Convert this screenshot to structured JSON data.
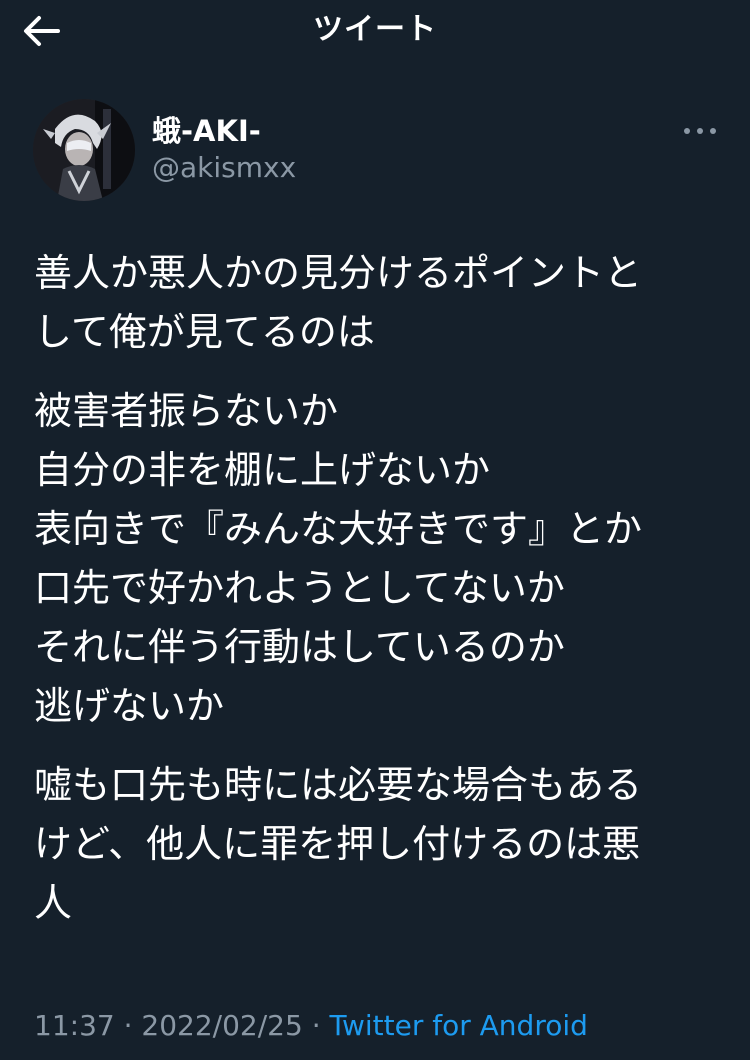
{
  "header": {
    "title": "ツイート"
  },
  "tweet": {
    "author": {
      "display_name": "蛾-AKI-",
      "handle": "@akismxx"
    },
    "paragraphs": [
      [
        "善人か悪人かの見分けるポイントと",
        "して俺が見てるのは"
      ],
      [
        "被害者振らないか",
        "自分の非を棚に上げないか",
        "表向きで『みんな大好きです』とか",
        "口先で好かれようとしてないか",
        "それに伴う行動はしているのか",
        "逃げないか"
      ],
      [
        "嘘も口先も時には必要な場合もある",
        "けど、他人に罪を押し付けるのは悪",
        "人"
      ]
    ],
    "time": "11:37",
    "separator1": " · ",
    "date": "2022/02/25",
    "separator2": " · ",
    "source": "Twitter for Android"
  },
  "colors": {
    "background": "#15202b",
    "text": "#ffffff",
    "secondary": "#8b98a5",
    "accent": "#1d9bf0"
  },
  "icons": {
    "back": "arrow-left-icon",
    "more": "more-dots-icon"
  }
}
